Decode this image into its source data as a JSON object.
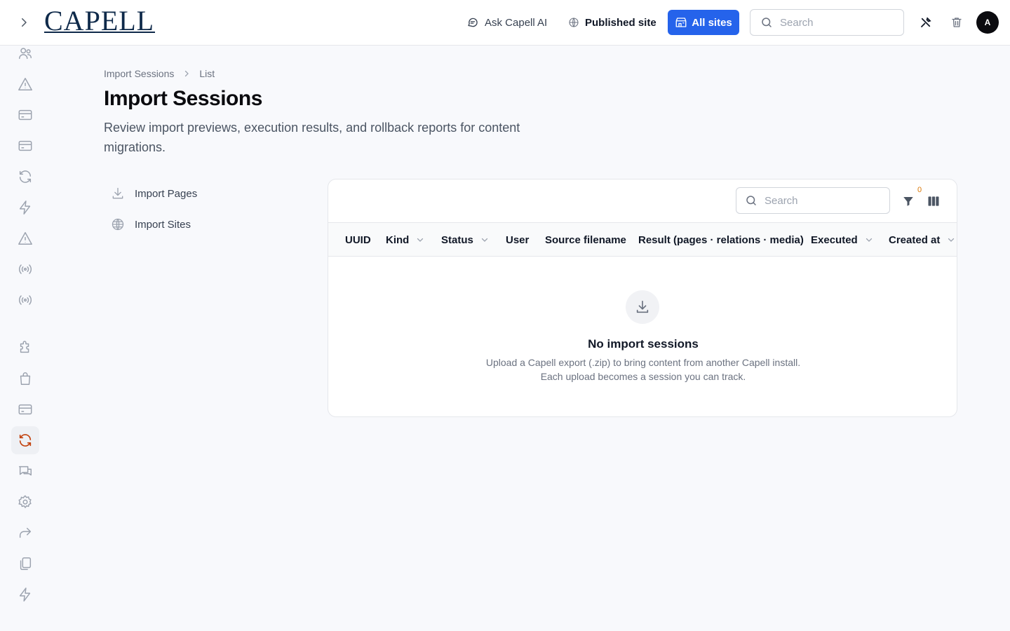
{
  "header": {
    "logo_text": "CAPELL",
    "ask_ai_label": "Ask Capell AI",
    "published_site_label": "Published site",
    "all_sites_label": "All sites",
    "search_placeholder": "Search",
    "avatar_initial": "A"
  },
  "sidebar": {
    "items": [
      {
        "icon": "users-icon"
      },
      {
        "icon": "warning-icon"
      },
      {
        "icon": "card-icon"
      },
      {
        "icon": "card-icon"
      },
      {
        "icon": "sync-icon"
      },
      {
        "icon": "bolt-icon"
      },
      {
        "icon": "warning-icon"
      },
      {
        "icon": "broadcast-icon"
      },
      {
        "icon": "broadcast-icon"
      },
      {
        "icon": "puzzle-icon"
      },
      {
        "icon": "bag-icon"
      },
      {
        "icon": "card-icon"
      },
      {
        "icon": "sync-icon",
        "active": true
      },
      {
        "icon": "chat-icon"
      },
      {
        "icon": "gear-icon"
      },
      {
        "icon": "share-icon"
      },
      {
        "icon": "copy-icon"
      },
      {
        "icon": "bolt-icon"
      }
    ],
    "active_color": "#c2410c"
  },
  "breadcrumb": {
    "parent": "Import Sessions",
    "current": "List"
  },
  "page": {
    "title": "Import Sessions",
    "description": "Review import previews, execution results, and rollback reports for content migrations."
  },
  "subnav": {
    "items": [
      {
        "label": "Import Pages",
        "icon": "download-icon"
      },
      {
        "label": "Import Sites",
        "icon": "globe-icon"
      }
    ]
  },
  "table": {
    "search_placeholder": "Search",
    "filter_count": "0",
    "columns": [
      {
        "label": "UUID",
        "sortable": false
      },
      {
        "label": "Kind",
        "sortable": true
      },
      {
        "label": "Status",
        "sortable": true
      },
      {
        "label": "User",
        "sortable": false
      },
      {
        "label": "Source filename",
        "sortable": false
      },
      {
        "label": "Result (pages · relations · media)",
        "sortable": false
      },
      {
        "label": "Executed",
        "sortable": true
      },
      {
        "label": "Created at",
        "sortable": true
      }
    ],
    "empty": {
      "title": "No import sessions",
      "line1": "Upload a Capell export (.zip) to bring content from another Capell install.",
      "line2": "Each upload becomes a session you can track."
    }
  },
  "colors": {
    "primary": "#2563eb",
    "accent_orange": "#c2410c",
    "badge": "#d97706"
  }
}
